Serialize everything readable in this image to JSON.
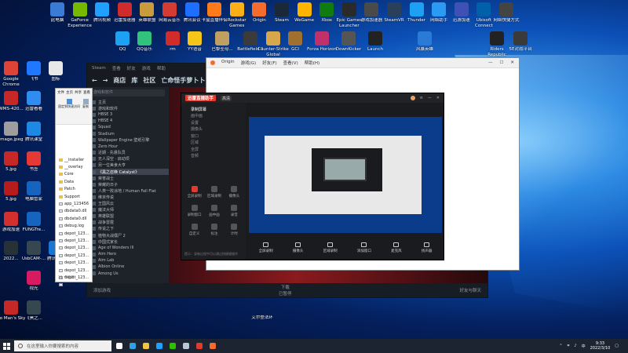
{
  "desktop_icons_row1": [
    {
      "label": "此电脑",
      "color": "#3a7bd5"
    },
    {
      "label": "GeForce Experience",
      "color": "#76b900"
    },
    {
      "label": "腾讯视频",
      "color": "#20a0ff"
    },
    {
      "label": "迅雷加速器",
      "color": "#d12c2c"
    },
    {
      "label": "英雄联盟",
      "color": "#c89b3c"
    },
    {
      "label": "网易云音乐",
      "color": "#d43c33"
    },
    {
      "label": "腾讯会议",
      "color": "#1e6fff"
    },
    {
      "label": "卡盒直播伴侣",
      "color": "#ff7a1a"
    },
    {
      "label": "Rockstar Games",
      "color": "#fcaf17"
    },
    {
      "label": "Origin",
      "color": "#f56c2d"
    },
    {
      "label": "Steam",
      "color": "#1b2838"
    },
    {
      "label": "WeGame",
      "color": "#ffb400"
    },
    {
      "label": "Xbox",
      "color": "#107c10"
    },
    {
      "label": "Epic Games Launcher",
      "color": "#2a2a2a"
    },
    {
      "label": "游戏加速器",
      "color": "#4a4a4a"
    },
    {
      "label": "SteamVR",
      "color": "#2a3f5a"
    },
    {
      "label": "Thunder",
      "color": "#1da1f2"
    },
    {
      "label": "网络助手",
      "color": "#2b9af3"
    },
    {
      "label": "迅游加速",
      "color": "#3f51b5"
    },
    {
      "label": "Ubisoft Connect",
      "color": "#0060a8"
    },
    {
      "label": "网络快捷方式",
      "color": "#444444"
    }
  ],
  "desktop_icons_row2": [
    {
      "label": "QQ",
      "color": "#1da1f2"
    },
    {
      "label": "QQ音乐",
      "color": "#31c27c"
    },
    {
      "label": "rm",
      "color": "#d12c2c"
    },
    {
      "label": "YY语音",
      "color": "#f5c518"
    },
    {
      "label": "巴黎圣母...",
      "color": "#c0a060"
    },
    {
      "label": "Battlefield 1",
      "color": "#3b3b3b"
    },
    {
      "label": "Counter-Strike Global",
      "color": "#d6a74b"
    },
    {
      "label": "GCI",
      "color": "#a07030"
    },
    {
      "label": "Forza Horizon",
      "color": "#c0306a"
    },
    {
      "label": "DownKicker",
      "color": "#555555"
    },
    {
      "label": "Launch",
      "color": "#222222"
    },
    {
      "label": "风暴英雄",
      "color": "#2a7bd8"
    },
    {
      "label": "Riders Republic",
      "color": "#222222"
    },
    {
      "label": "5E对战平台",
      "color": "#3a3a3a"
    }
  ],
  "desktop_icons_col": [
    {
      "label": "Google Chrome",
      "color": "#db4437"
    },
    {
      "label": "飞书",
      "color": "#1f78ff"
    },
    {
      "label": "图标",
      "color": "#e8e8e8"
    },
    {
      "label": "WMS-420...",
      "color": "#c62828"
    },
    {
      "label": "迅雷看看",
      "color": "#2f8cf0"
    },
    {
      "label": "image.jpeg",
      "color": "#9e9e9e"
    },
    {
      "label": "腾讯课堂",
      "color": "#1e88e5"
    },
    {
      "label": "5.jpg",
      "color": "#c62828"
    },
    {
      "label": "书签",
      "color": "#e53935"
    },
    {
      "label": "5.jpg",
      "color": "#b71c1c"
    },
    {
      "label": "电脑管家",
      "color": "#1565c0"
    },
    {
      "label": "游戏加速",
      "color": "#d32f2f"
    },
    {
      "label": "FUNGTre...",
      "color": "#1565c0"
    },
    {
      "label": "2022...",
      "color": "#263238"
    },
    {
      "label": "UsbCAM-...",
      "color": "#37474f"
    },
    {
      "label": "腾讯加速",
      "color": "#1976d2"
    },
    {
      "label": "视光",
      "color": "#d81b60"
    },
    {
      "label": "No Man's Sky",
      "color": "#c62828"
    },
    {
      "label": "《黑之...",
      "color": "#37474f"
    }
  ],
  "bottom_desktop_icon": {
    "label": "艾尔登法环",
    "color": "#8a6d2c"
  },
  "steam": {
    "title_menu": [
      "Steam",
      "查看",
      "好友",
      "游戏",
      "帮助"
    ],
    "nav": [
      "商店",
      "库",
      "社区",
      "亡命怪手萝卜卜"
    ],
    "search_placeholder": "游戏和软件",
    "library_items": [
      "主页",
      "游戏和软件",
      "HBSE 3",
      "HBSE 4",
      "Squad",
      "Stadium",
      "Wallpaper Engine  壁纸引擎",
      "Zero Hour",
      "近期 · 先遣队员",
      "无人深空 · 启动项",
      "另一位美食大亨",
      "《黑之召唤 Catalyst》",
      "荣誉战士",
      "荣耀的日子",
      "人类一败涂地 / Human Fall Flat",
      "维京传说",
      "王国风云",
      "魔法大师",
      "英雄联盟",
      "战争雷霆",
      "传说之下",
      "植物大战僵尸 2",
      "中国式家长",
      "Age of Wonders III",
      "Aim Hero",
      "Aim Lab",
      "Albion Online",
      "Among Us"
    ],
    "highlighted_index": 11,
    "footer_add": "添加游戏",
    "footer_download": "下载",
    "footer_download_sub": "已暂停",
    "footer_friends": "好友与聊天"
  },
  "explorer": {
    "tabs": [
      "文件",
      "主页",
      "共享",
      "查看"
    ],
    "pin_label": "固定到快速访问",
    "copy_label": "复制",
    "items": [
      {
        "name": "__installer",
        "type": "folder"
      },
      {
        "name": "__overlay",
        "type": "folder"
      },
      {
        "name": "Core",
        "type": "folder"
      },
      {
        "name": "Data",
        "type": "folder"
      },
      {
        "name": "Patch",
        "type": "folder"
      },
      {
        "name": "Support",
        "type": "folder"
      },
      {
        "name": "app_123456",
        "type": "file"
      },
      {
        "name": "dbdata0.dll",
        "type": "file"
      },
      {
        "name": "dbdata0.dll",
        "type": "file"
      },
      {
        "name": "debug.log",
        "type": "file"
      },
      {
        "name": "depot_123...",
        "type": "file"
      },
      {
        "name": "depot_123...",
        "type": "file"
      },
      {
        "name": "depot_123...",
        "type": "file"
      },
      {
        "name": "depot_123...",
        "type": "file"
      },
      {
        "name": "depot_123...",
        "type": "file"
      },
      {
        "name": "depot_123...",
        "type": "file"
      },
      {
        "name": "depot_123...",
        "type": "file"
      },
      {
        "name": "depot_123...",
        "type": "file"
      }
    ],
    "status": "31 个项目"
  },
  "origin": {
    "title": "Origin",
    "menu": [
      "Origin",
      "游戏(G)",
      "好友(F)",
      "查看(V)",
      "帮助(H)"
    ]
  },
  "recorder": {
    "app_name": "迅雷直播助手",
    "version": "高清",
    "menu": [
      "录制屏幕",
      "画中画",
      "设置",
      "摄像头",
      "窗口",
      "区域",
      "全屏",
      "音频"
    ],
    "tools": [
      "全屏录制",
      "区域录制",
      "摄像头",
      "录制窗口",
      "画中画",
      "录音",
      "自定义",
      "标注",
      "计时"
    ],
    "bottom_bar": [
      "全屏录制",
      "摄像头",
      "区域录制",
      "添加窗口",
      "麦克风",
      "扬声器"
    ],
    "footer_hint": "提示：录制过程中可以通过快捷键操作"
  },
  "taskbar": {
    "search_placeholder": "在这里输入你要搜索的内容",
    "apps": [
      {
        "name": "task-view",
        "color": "#ffffff"
      },
      {
        "name": "edge",
        "color": "#2fa1e4"
      },
      {
        "name": "explorer",
        "color": "#f2c244"
      },
      {
        "name": "qq",
        "color": "#1ea1ff"
      },
      {
        "name": "wechat",
        "color": "#2dc100"
      },
      {
        "name": "steam",
        "color": "#b8c6d6"
      },
      {
        "name": "recorder",
        "color": "#e23b2e"
      },
      {
        "name": "origin",
        "color": "#f56c2d"
      }
    ],
    "time": "9:33",
    "date": "2022/3/10",
    "lang": "中"
  }
}
